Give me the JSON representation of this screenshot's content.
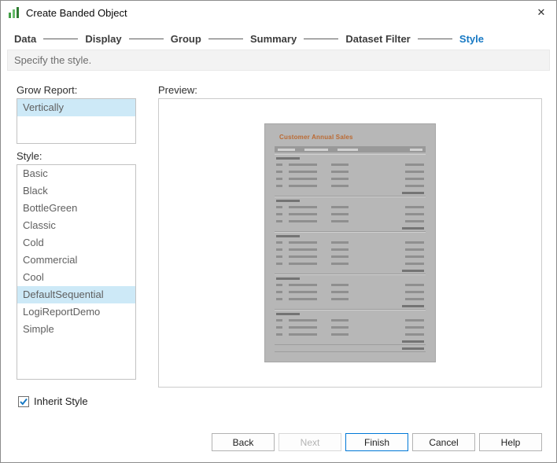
{
  "window": {
    "title": "Create Banded Object",
    "close_glyph": "✕"
  },
  "wizard": {
    "steps": [
      {
        "label": "Data"
      },
      {
        "label": "Display"
      },
      {
        "label": "Group"
      },
      {
        "label": "Summary"
      },
      {
        "label": "Dataset Filter"
      },
      {
        "label": "Style"
      }
    ],
    "active_step": "Style",
    "subtitle": "Specify the style."
  },
  "grow_report": {
    "label": "Grow Report:",
    "options": [
      "Vertically"
    ],
    "selected": "Vertically"
  },
  "style_panel": {
    "label": "Style:",
    "options": [
      "Basic",
      "Black",
      "BottleGreen",
      "Classic",
      "Cold",
      "Commercial",
      "Cool",
      "DefaultSequential",
      "LogiReportDemo",
      "Simple"
    ],
    "selected": "DefaultSequential"
  },
  "inherit_style": {
    "label": "Inherit Style",
    "checked": true
  },
  "preview": {
    "label": "Preview:",
    "report_title": "Customer Annual Sales"
  },
  "buttons": {
    "back": "Back",
    "next": "Next",
    "finish": "Finish",
    "cancel": "Cancel",
    "help": "Help"
  },
  "colors": {
    "accent_blue": "#1779c4",
    "selection_blue": "#cde9f7",
    "finish_border": "#0078d7"
  }
}
